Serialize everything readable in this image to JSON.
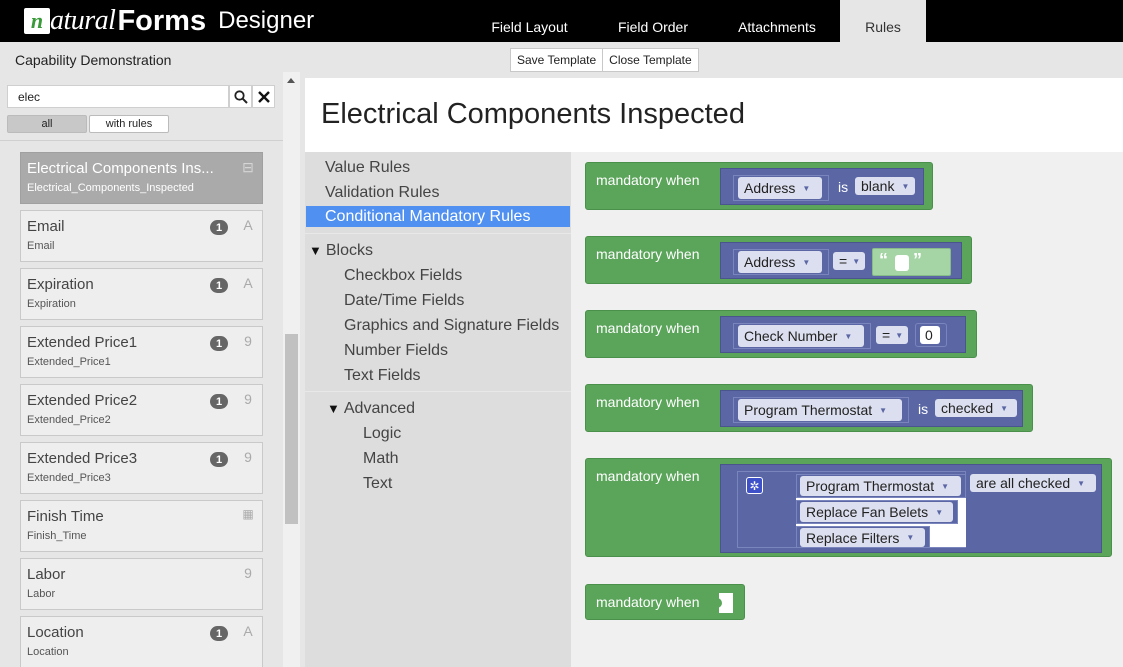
{
  "app": {
    "logo_n": "n",
    "logo_natural": "atural",
    "logo_forms": "Forms",
    "logo_designer": "Designer"
  },
  "tabs": [
    {
      "label": "Field Layout"
    },
    {
      "label": "Field Order"
    },
    {
      "label": "Attachments"
    },
    {
      "label": "Rules"
    }
  ],
  "subheader": {
    "form_name": "Capability Demonstration",
    "save_label": "Save Template",
    "close_label": "Close Template"
  },
  "sidebar": {
    "search_value": "elec",
    "filter_all": "all",
    "filter_rules": "with rules",
    "fields": [
      {
        "title": "Electrical Components Ins...",
        "sub": "Electrical_Components_Inspected",
        "badge": "",
        "type_icon": "⊟"
      },
      {
        "title": "Email",
        "sub": "Email",
        "badge": "1",
        "type_icon": "A"
      },
      {
        "title": "Expiration",
        "sub": "Expiration",
        "badge": "1",
        "type_icon": "A"
      },
      {
        "title": "Extended Price1",
        "sub": "Extended_Price1",
        "badge": "1",
        "type_icon": "9"
      },
      {
        "title": "Extended Price2",
        "sub": "Extended_Price2",
        "badge": "1",
        "type_icon": "9"
      },
      {
        "title": "Extended Price3",
        "sub": "Extended_Price3",
        "badge": "1",
        "type_icon": "9"
      },
      {
        "title": "Finish Time",
        "sub": "Finish_Time",
        "badge": "",
        "type_icon": "▦"
      },
      {
        "title": "Labor",
        "sub": "Labor",
        "badge": "",
        "type_icon": "9"
      },
      {
        "title": "Location",
        "sub": "Location",
        "badge": "1",
        "type_icon": "A"
      }
    ]
  },
  "main": {
    "title": "Electrical Components Inspected"
  },
  "toolbox": {
    "value_rules": "Value Rules",
    "validation_rules": "Validation Rules",
    "conditional_mandatory": "Conditional Mandatory Rules",
    "blocks": "Blocks",
    "checkbox": "Checkbox Fields",
    "datetime": "Date/Time Fields",
    "graphics": "Graphics and Signature Fields",
    "number": "Number Fields",
    "text": "Text Fields",
    "advanced": "Advanced",
    "logic": "Logic",
    "math": "Math",
    "text2": "Text",
    "expand_glyph": "▼"
  },
  "blocks": {
    "mandatory_label": "mandatory when",
    "b1": {
      "field": "Address",
      "op": "is",
      "value": "blank"
    },
    "b2": {
      "field": "Address",
      "op": "=",
      "quote_open": "“",
      "quote_close": "”"
    },
    "b3": {
      "field": "Check Number",
      "op": "=",
      "value": "0"
    },
    "b4": {
      "field": "Program Thermostat",
      "op": "is",
      "value": "checked"
    },
    "b5": {
      "field1": "Program Thermostat",
      "field2": "Replace Fan Belets",
      "field3": "Replace Filters",
      "cond": "are all checked"
    }
  },
  "colors": {
    "mandatory_block": "#5ba55b",
    "field_block": "#5b67a5",
    "active_toolbox": "#4f90f0"
  }
}
